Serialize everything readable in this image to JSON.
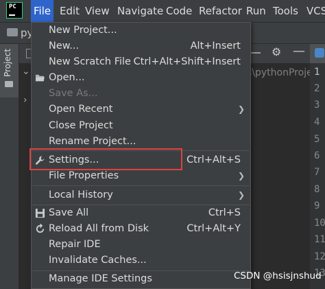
{
  "menubar": {
    "items": [
      "File",
      "Edit",
      "View",
      "Navigate",
      "Code",
      "Refactor",
      "Run",
      "Tools",
      "VCS"
    ]
  },
  "toolbar": {
    "project_prefix": "py"
  },
  "left_strip": {
    "project_tab": "Project"
  },
  "editor": {
    "path_fragment": "s\\pythonProje",
    "line_numbers": [
      "1",
      "2",
      "3",
      "4",
      "5",
      "6",
      "7",
      "8",
      "9",
      "10",
      "11",
      "12",
      "13"
    ]
  },
  "file_menu": {
    "new_project": "New Project...",
    "new": "New...",
    "new_shortcut": "Alt+Insert",
    "new_scratch": "New Scratch File",
    "new_scratch_shortcut": "Ctrl+Alt+Shift+Insert",
    "open": "Open...",
    "save_as": "Save As...",
    "open_recent": "Open Recent",
    "close_project": "Close Project",
    "rename_project": "Rename Project...",
    "settings": "Settings...",
    "settings_shortcut": "Ctrl+Alt+S",
    "file_properties": "File Properties",
    "local_history": "Local History",
    "save_all": "Save All",
    "save_all_shortcut": "Ctrl+S",
    "reload": "Reload All from Disk",
    "reload_shortcut": "Ctrl+Alt+Y",
    "repair": "Repair IDE",
    "invalidate": "Invalidate Caches...",
    "manage_settings": "Manage IDE Settings"
  },
  "watermark": "CSDN @hsisjnshud",
  "colors": {
    "menu_bg": "#3c3f41",
    "active_menu": "#2f65ca",
    "highlight_border": "#e04040"
  }
}
